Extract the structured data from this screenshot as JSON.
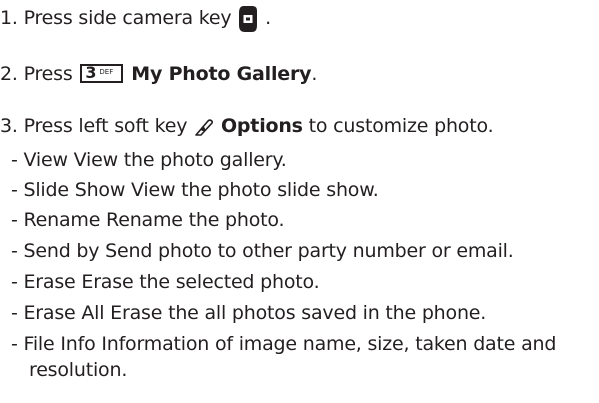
{
  "steps": [
    {
      "prefix": "1. Press side camera key",
      "suffix": ".",
      "icon": "camera-key-icon"
    },
    {
      "prefix": "2. Press",
      "key_digit": "3",
      "key_letters": "DEF",
      "bold_text": "My Photo Gallery",
      "suffix": "."
    },
    {
      "prefix": "3. Press left soft key",
      "icon": "left-soft-key-icon",
      "bold_text": "Options",
      "suffix": "to customize photo."
    }
  ],
  "options": [
    "- View  View the photo gallery.",
    "- Slide Show  View the photo slide show.",
    "- Rename  Rename the photo.",
    "- Send by  Send photo to other party number or email.",
    "- Erase  Erase the selected photo.",
    "- Erase All  Erase the all photos saved in the phone.",
    "- File Info  Information of image name, size, taken date and",
    "resolution."
  ]
}
